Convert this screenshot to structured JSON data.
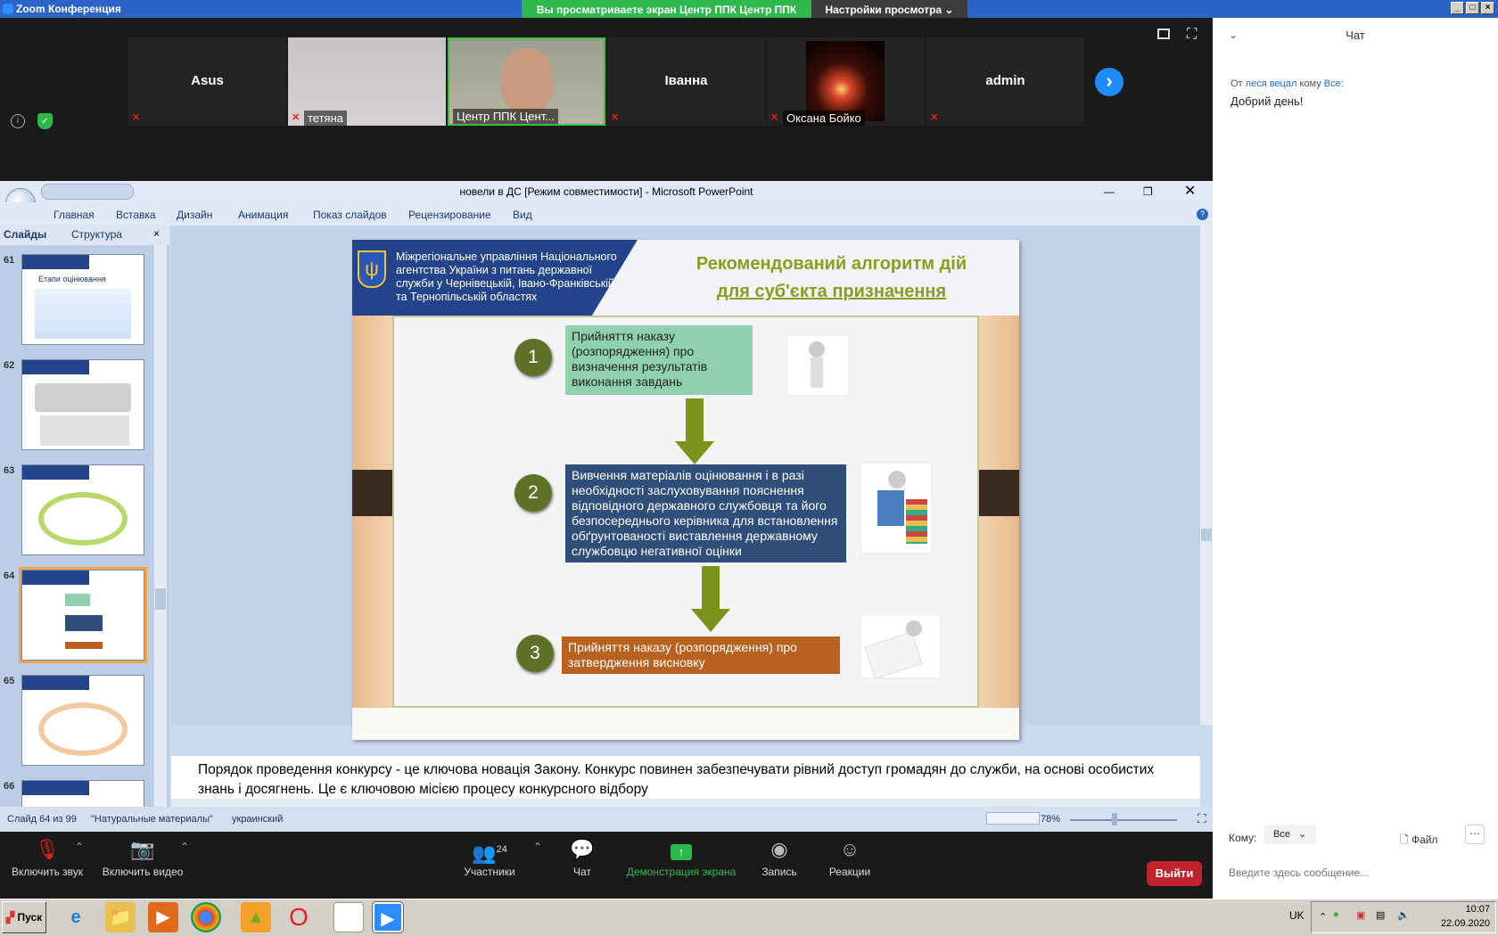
{
  "zoom": {
    "app_title": "Zoom Конференция",
    "share_banner": "Вы просматриваете экран Центр ППК Центр ППК",
    "view_options": "Настройки просмотра",
    "participants": [
      {
        "name": "Asus",
        "caption": ""
      },
      {
        "name": "",
        "caption": "тетяна"
      },
      {
        "name": "",
        "caption": "Центр ППК Цент..."
      },
      {
        "name": "Іванна",
        "caption": ""
      },
      {
        "name": "",
        "caption": "Оксана Бойко"
      },
      {
        "name": "admin",
        "caption": ""
      }
    ],
    "toolbar": {
      "audio": "Включить звук",
      "video": "Включить видео",
      "participants": "Участники",
      "participants_count": "24",
      "chat": "Чат",
      "share": "Демонстрация экрана",
      "record": "Запись",
      "reactions": "Реакции",
      "leave": "Выйти"
    }
  },
  "chat": {
    "title": "Чат",
    "message": {
      "from_label": "От",
      "sender": "леся вецал",
      "to_label": "кому",
      "recipient": "Все:",
      "text": "Добрий день!"
    },
    "to_label": "Кому:",
    "to_value": "Все",
    "file_label": "Файл",
    "input_placeholder": "Введите здесь сообщение..."
  },
  "ppt": {
    "window_title": "новели в ДС [Режим совместимости] - Microsoft PowerPoint",
    "ribbon_tabs": [
      "Главная",
      "Вставка",
      "Дизайн",
      "Анимация",
      "Показ слайдов",
      "Рецензирование",
      "Вид"
    ],
    "pane_tabs": [
      "Слайды",
      "Структура"
    ],
    "thumb_numbers": [
      "61",
      "62",
      "63",
      "64",
      "65",
      "66"
    ],
    "thumb61_title": "Етапи оцінювання",
    "slide": {
      "org": "Міжрегіональне управління Національного агентства України з питань державної служби у Чернівецькій, Івано-Франківській та Тернопільській областях",
      "title_line1": "Рекомендований алгоритм дій",
      "title_line2": "для суб'єкта призначення",
      "steps": [
        {
          "num": "1",
          "text": "Прийняття наказу (розпорядження) про визначення результатів виконання завдань"
        },
        {
          "num": "2",
          "text": "Вивчення матеріалів оцінювання і в разі необхідності заслуховування пояснення відповідного державного службовця та його безпосереднього керівника для встановлення обґрунтованості виставлення державному службовцю негативної оцінки"
        },
        {
          "num": "3",
          "text": "Прийняття наказу (розпорядження) про затвердження висновку"
        }
      ]
    },
    "notes": "Порядок проведення конкурсу - це ключова новація Закону. Конкурс повинен забезпечувати рівний доступ громадян до служби, на основі особистих знань і досягнень. Це є ключовою місією процесу конкурсного відбору",
    "status": {
      "slide_pos": "Слайд 64 из 99",
      "theme": "\"Натуральные материалы\"",
      "language": "украинский",
      "zoom": "78%"
    }
  },
  "taskbar": {
    "start": "Пуск",
    "lang": "UK",
    "time": "10:07",
    "date": "22.09.2020"
  },
  "colors": {
    "zoom_blue": "#2d8cff",
    "share_green": "#2db84c",
    "leave_red": "#c0222c",
    "slide_green": "#5f7129",
    "slide_title": "#8b9c1e"
  }
}
